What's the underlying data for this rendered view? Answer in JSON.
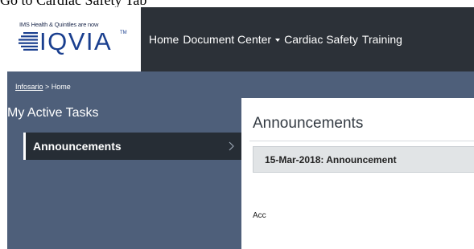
{
  "caption": "Go to Cardiac Safety Tab",
  "logo": {
    "tagline": "IMS Health & Quintiles are now",
    "wordmark": "IQVIA",
    "tm": "TM"
  },
  "nav": {
    "home": "Home",
    "document_center": "Document Center",
    "cardiac_safety": "Cardiac Safety",
    "training": "Training"
  },
  "breadcrumb": {
    "root": "Infosario",
    "separator": " > ",
    "current": "Home"
  },
  "sidebar": {
    "heading": "My Active Tasks",
    "items": [
      {
        "label": "Announcements"
      }
    ]
  },
  "main": {
    "title": "Announcements",
    "announcement": "15-Mar-2018: Announcement",
    "body_text": "Acc"
  },
  "colors": {
    "navbar": "#2c3138",
    "sidebar": "#4e5f7a",
    "brand_blue": "#1a3f8f",
    "active_item": "#262d35"
  },
  "icons": [
    "iqvia-logo-mark-icon",
    "caret-down-icon",
    "chevron-right-icon"
  ]
}
